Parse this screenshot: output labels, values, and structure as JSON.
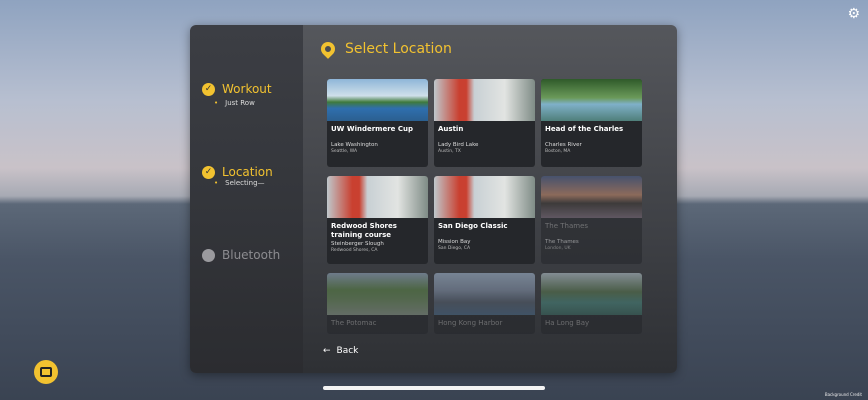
{
  "sidebar": {
    "steps": [
      {
        "label": "Workout",
        "sub": "Just Row",
        "state": "done"
      },
      {
        "label": "Location",
        "sub": "Selecting—",
        "state": "done"
      },
      {
        "label": "Bluetooth",
        "state": "pending"
      }
    ]
  },
  "main": {
    "title": "Select Location",
    "back_label": "Back",
    "locations": [
      {
        "name": "UW Windermere Cup",
        "water": "Lake Washington",
        "city": "Seattle, WA",
        "bg": "linear-gradient(180deg,#8fb6d8 0%,#cfe0ea 40%,#3f7a3c 55%,#2f6fae 70%,#2b5f8f 100%)"
      },
      {
        "name": "Austin",
        "water": "Lady Bird Lake",
        "city": "Austin, TX",
        "bg": "linear-gradient(90deg,#bfc8cc 0%,#c94030 25%,#c94030 32%,#c8d0d4 40%,#e2e4e2 70%,#7f8c86 100%)"
      },
      {
        "name": "Head of the Charles",
        "water": "Charles River",
        "city": "Boston, MA",
        "bg": "linear-gradient(180deg,#2f5a2a 0%,#6b9a5a 45%,#7fb0c9 60%,#4f7f7a 100%)"
      },
      {
        "name": "Redwood Shores training course",
        "water": "Steinberger Slough",
        "city": "Redwood Shores, CA",
        "bg": "linear-gradient(90deg,#bfc8cc 0%,#c94030 25%,#c94030 32%,#c8d0d4 40%,#e2e4e2 70%,#7f8c86 100%)"
      },
      {
        "name": "San Diego Classic",
        "water": "Mission Bay",
        "city": "San Diego, CA",
        "bg": "linear-gradient(90deg,#bfc8cc 0%,#c94030 25%,#c94030 32%,#c8d0d4 40%,#e2e4e2 70%,#7f8c86 100%)"
      },
      {
        "name": "The Thames",
        "water": "The Thames",
        "city": "London, UK",
        "bg": "linear-gradient(180deg,#4a5c8a 0%,#c98a6a 45%,#3a3430 65%,#7a6a78 100%)",
        "dim": true
      },
      {
        "name": "The Potomac",
        "bg": "linear-gradient(180deg,#9ab0c8 0%,#5f8a4a 40%,#6a8e5a 60%,#8a9a8a 100%)",
        "dim": true
      },
      {
        "name": "Hong Kong Harbor",
        "bg": "linear-gradient(180deg,#aac0d8 0%,#8898b0 40%,#556070 70%,#4a6a8a 100%)",
        "dim": true
      },
      {
        "name": "Ha Long Bay",
        "bg": "linear-gradient(180deg,#c0d0d8 0%,#5a7a50 45%,#4a8a80 70%,#3a6a60 100%)",
        "dim": true
      }
    ]
  },
  "credit": "Background Credit"
}
